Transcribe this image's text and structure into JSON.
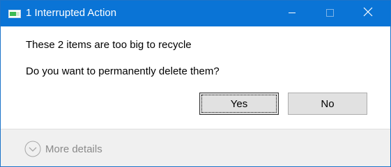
{
  "window": {
    "title": "1 Interrupted Action",
    "accent_color": "#0a74d6"
  },
  "message": {
    "line1": "These 2 items are too big to recycle",
    "line2": "Do you want to permanently delete them?"
  },
  "buttons": {
    "yes_label": "Yes",
    "no_label": "No"
  },
  "footer": {
    "details_label": "More details",
    "details_icon": "chevron-down-icon"
  },
  "icons": {
    "app": "file-operation-icon",
    "minimize": "minimize-icon",
    "maximize": "maximize-icon",
    "close": "close-icon"
  }
}
